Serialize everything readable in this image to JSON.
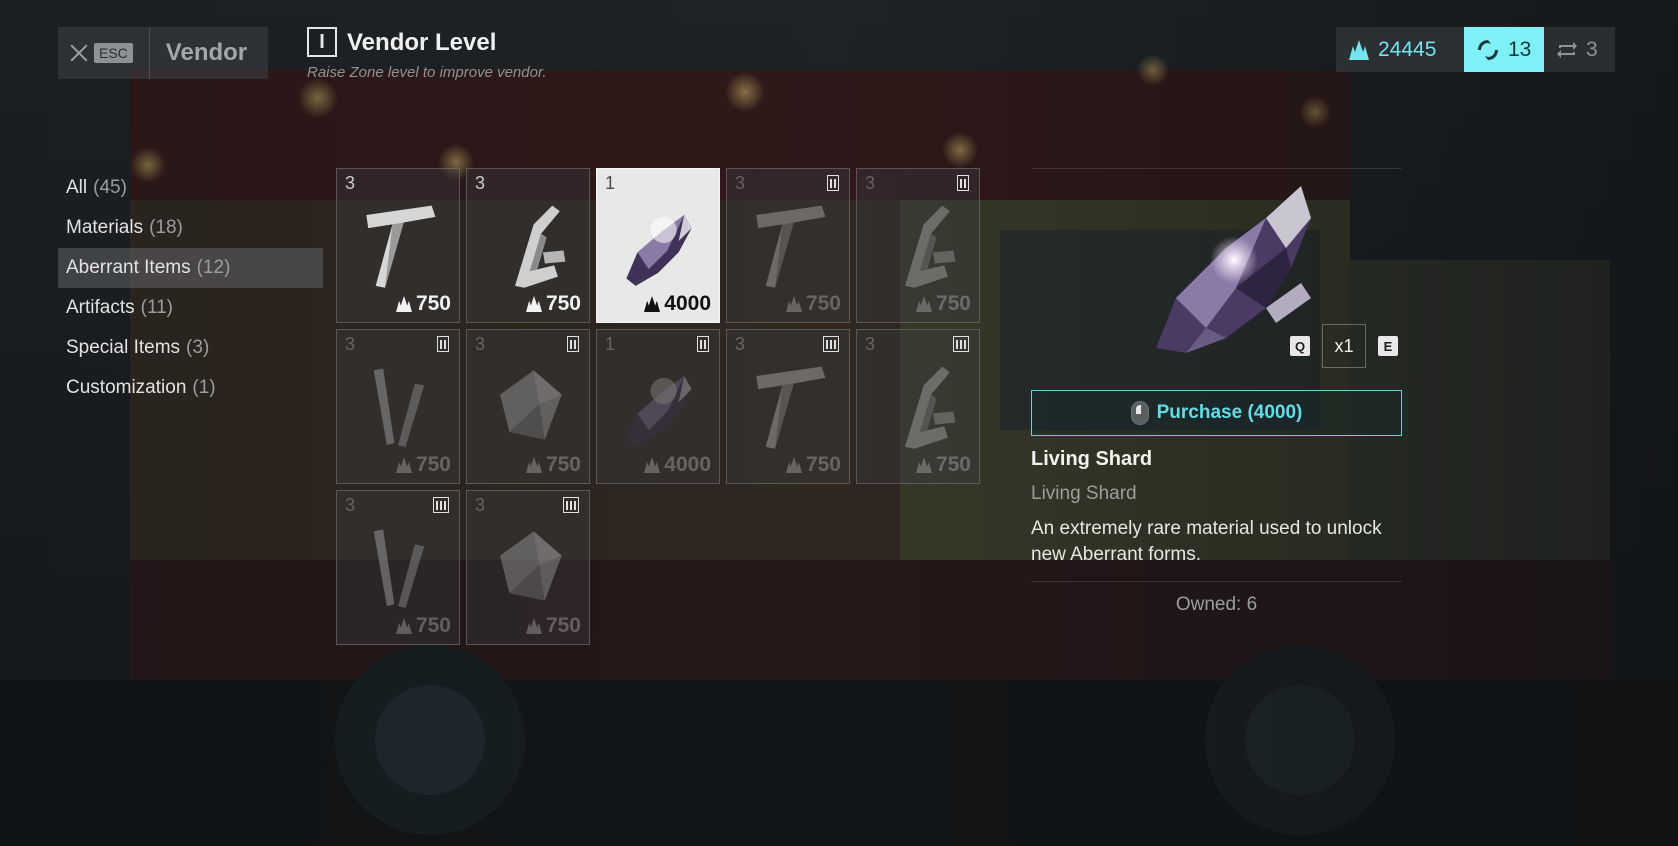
{
  "header": {
    "esc_key": "ESC",
    "title": "Vendor",
    "vendor_level": {
      "icon_text": "I",
      "title": "Vendor Level",
      "subtitle": "Raise Zone level to improve vendor."
    }
  },
  "currencies": [
    {
      "icon": "crystal-currency-icon",
      "value": "24445"
    },
    {
      "icon": "cycle-token-icon",
      "value": "13"
    },
    {
      "icon": "refresh-token-icon",
      "value": "3"
    }
  ],
  "categories": [
    {
      "label": "All",
      "count": "(45)",
      "active": false
    },
    {
      "label": "Materials",
      "count": "(18)",
      "active": false
    },
    {
      "label": "Aberrant Items",
      "count": "(12)",
      "active": true
    },
    {
      "label": "Artifacts",
      "count": "(11)",
      "active": false
    },
    {
      "label": "Special Items",
      "count": "(3)",
      "active": false
    },
    {
      "label": "Customization",
      "count": "(1)",
      "active": false
    }
  ],
  "items": [
    {
      "qty": "3",
      "price": "750",
      "art": "shard-t",
      "tier": 0,
      "locked": false,
      "selected": false
    },
    {
      "qty": "3",
      "price": "750",
      "art": "shard-claw",
      "tier": 0,
      "locked": false,
      "selected": false
    },
    {
      "qty": "1",
      "price": "4000",
      "art": "living-shard",
      "tier": 0,
      "locked": false,
      "selected": true
    },
    {
      "qty": "3",
      "price": "750",
      "art": "shard-t",
      "tier": 2,
      "locked": true,
      "selected": false
    },
    {
      "qty": "3",
      "price": "750",
      "art": "shard-claw",
      "tier": 2,
      "locked": true,
      "selected": false
    },
    {
      "qty": "3",
      "price": "750",
      "art": "shard-v",
      "tier": 2,
      "locked": true,
      "selected": false
    },
    {
      "qty": "3",
      "price": "750",
      "art": "shard-chunk",
      "tier": 2,
      "locked": true,
      "selected": false
    },
    {
      "qty": "1",
      "price": "4000",
      "art": "living-shard",
      "tier": 2,
      "locked": true,
      "selected": false
    },
    {
      "qty": "3",
      "price": "750",
      "art": "shard-t",
      "tier": 3,
      "locked": true,
      "selected": false
    },
    {
      "qty": "3",
      "price": "750",
      "art": "shard-claw",
      "tier": 3,
      "locked": true,
      "selected": false
    },
    {
      "qty": "3",
      "price": "750",
      "art": "shard-v",
      "tier": 3,
      "locked": true,
      "selected": false
    },
    {
      "qty": "3",
      "price": "750",
      "art": "shard-chunk",
      "tier": 3,
      "locked": true,
      "selected": false
    }
  ],
  "detail": {
    "key_decrease": "Q",
    "quantity": "x1",
    "key_increase": "E",
    "purchase_label": "Purchase (4000)",
    "name": "Living Shard",
    "type": "Living Shard",
    "description": "An extremely rare material used to unlock new Aberrant forms.",
    "owned": "Owned: 6"
  },
  "colors": {
    "accent": "#62dde8",
    "accent_bg": "#7ff0f7"
  }
}
